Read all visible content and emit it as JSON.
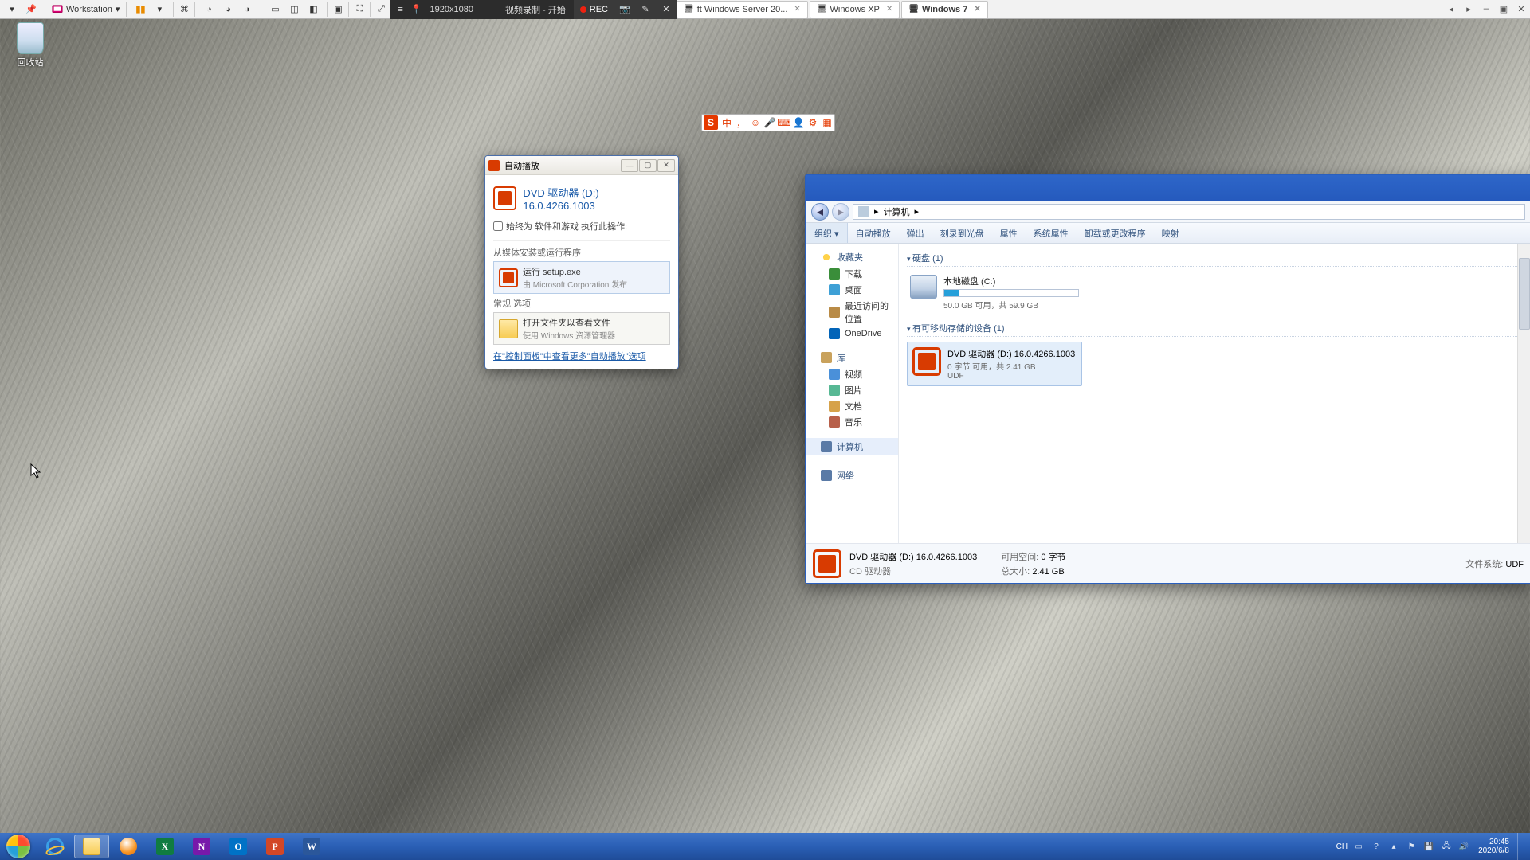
{
  "vmware_bar": {
    "workstation_label": "Workstation",
    "resolution": "1920x1080",
    "recording_label": "视频录制 - 开始",
    "rec_badge": "REC",
    "tabs": [
      {
        "label": "ft Windows Server 20..."
      },
      {
        "label": "Windows XP"
      },
      {
        "label": "Windows 7",
        "active": true
      }
    ]
  },
  "desktop": {
    "recycle_bin": "回收站"
  },
  "ime": {
    "lang": "中"
  },
  "autoplay": {
    "window_title": "自动播放",
    "drive_title": "DVD 驱动器 (D:) 16.0.4266.1003",
    "always_label": "始终为 软件和游戏 执行此操作:",
    "section_install": "从媒体安装或运行程序",
    "run_l1": "运行 setup.exe",
    "run_l2": "由 Microsoft Corporation 发布",
    "section_general": "常规 选项",
    "view_l1": "打开文件夹以查看文件",
    "view_l2": "使用 Windows 资源管理器",
    "footer_link": "在\"控制面板\"中查看更多\"自动播放\"选项"
  },
  "explorer": {
    "breadcrumb_root": "计算机",
    "toolbar": {
      "organize": "组织 ▾",
      "items": [
        "自动播放",
        "弹出",
        "刻录到光盘",
        "属性",
        "系统属性",
        "卸载或更改程序",
        "映射"
      ]
    },
    "nav": {
      "favorites": "收藏夹",
      "downloads": "下载",
      "desktop": "桌面",
      "recent": "最近访问的位置",
      "onedrive": "OneDrive",
      "libraries": "库",
      "videos": "视频",
      "pictures": "图片",
      "documents": "文档",
      "music": "音乐",
      "computer": "计算机",
      "network": "网络"
    },
    "groups": {
      "hdd_header": "硬盘 (1)",
      "hdd_name": "本地磁盘 (C:)",
      "hdd_info": "50.0 GB 可用，共 59.9 GB",
      "removable_header": "有可移动存储的设备 (1)",
      "dvd_name": "DVD 驱动器 (D:) 16.0.4266.1003",
      "dvd_info": "0 字节 可用，共 2.41 GB",
      "dvd_fs": "UDF"
    },
    "status": {
      "title": "DVD 驱动器 (D:) 16.0.4266.1003",
      "sub": "CD 驱动器",
      "free_k": "可用空间:",
      "free_v": "0 字节",
      "size_k": "总大小:",
      "size_v": "2.41 GB",
      "fs_k": "文件系统:",
      "fs_v": "UDF"
    }
  },
  "taskbar": {
    "lang": "CH",
    "time": "20:45",
    "date": "2020/6/8"
  }
}
